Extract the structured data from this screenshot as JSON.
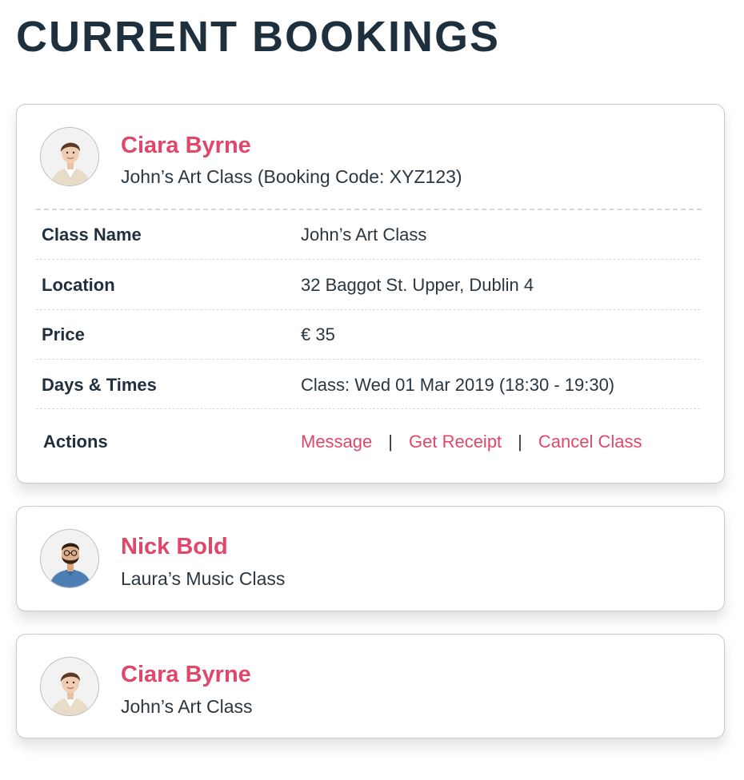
{
  "page": {
    "title": "CURRENT BOOKINGS"
  },
  "bookings": [
    {
      "name": "Ciara Byrne",
      "subtitle": "John’s Art Class (Booking Code: XYZ123)",
      "avatar_icon": "woman-portrait-icon",
      "details": [
        {
          "label": "Class Name",
          "value": "John’s Art Class"
        },
        {
          "label": "Location",
          "value": "32 Baggot St. Upper, Dublin 4"
        },
        {
          "label": "Price",
          "value": "€ 35"
        },
        {
          "label": "Days & Times",
          "value": "Class: Wed 01 Mar 2019 (18:30 - 19:30)"
        }
      ],
      "actions_label": "Actions",
      "actions": [
        {
          "label": "Message"
        },
        {
          "label": "Get Receipt"
        },
        {
          "label": "Cancel Class"
        }
      ],
      "separator": "|"
    },
    {
      "name": "Nick Bold",
      "subtitle": "Laura’s Music Class",
      "avatar_icon": "man-portrait-icon"
    },
    {
      "name": "Ciara Byrne",
      "subtitle": "John’s Art Class",
      "avatar_icon": "woman-portrait-icon"
    }
  ],
  "colors": {
    "accent": "#e0476a",
    "title": "#1e2f3e",
    "text": "#2a3640"
  }
}
